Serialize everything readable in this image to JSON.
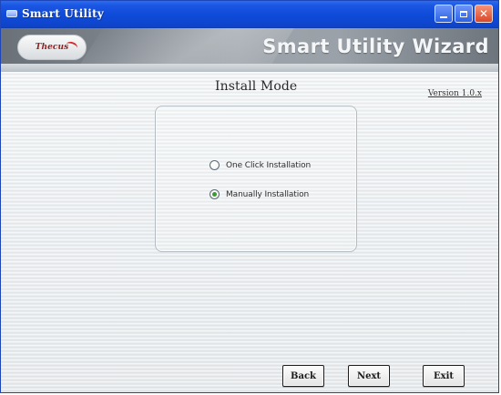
{
  "window": {
    "title": "Smart Utility"
  },
  "banner": {
    "logo_text": "Thecus",
    "title": "Smart Utility Wizard"
  },
  "main": {
    "heading": "Install Mode",
    "version_text": "Version 1.0.x",
    "options": [
      {
        "label": "One Click Installation",
        "selected": false
      },
      {
        "label": "Manually Installation",
        "selected": true
      }
    ]
  },
  "buttons": {
    "back": "Back",
    "next": "Next",
    "exit": "Exit"
  },
  "colors": {
    "titlebar_blue": "#0f4bd9",
    "selected_radio": "#3d9a2e",
    "banner_gray": "#8e959c"
  },
  "icons": {
    "app": "app-icon",
    "minimize": "minimize-icon",
    "maximize": "maximize-icon",
    "close": "close-icon",
    "radio": "radio-button-icon"
  }
}
